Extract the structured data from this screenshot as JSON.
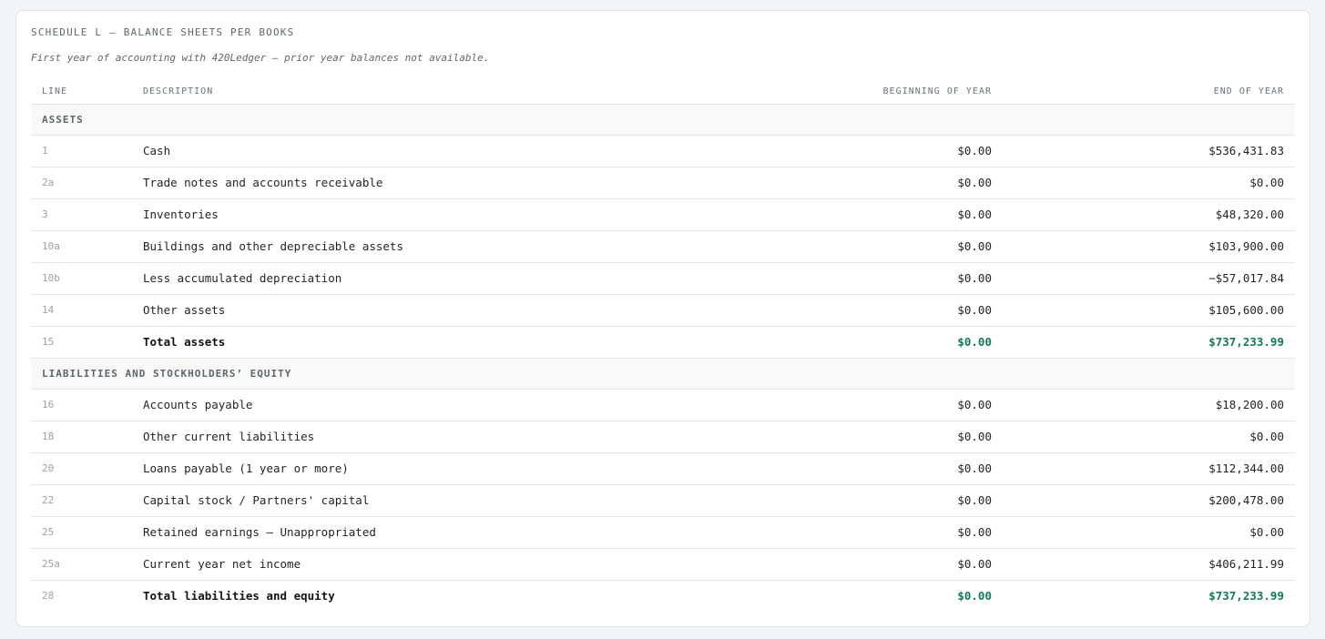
{
  "schedule": {
    "title": "SCHEDULE L — BALANCE SHEETS PER BOOKS",
    "note": "First year of accounting with 420Ledger — prior year balances not available."
  },
  "columns": {
    "line": "LINE",
    "description": "DESCRIPTION",
    "beginning": "BEGINNING OF YEAR",
    "end": "END OF YEAR"
  },
  "sections": [
    {
      "title": "ASSETS",
      "rows": [
        {
          "line": "1",
          "description": "Cash",
          "beginning": "$0.00",
          "end": "$536,431.83",
          "total": false
        },
        {
          "line": "2a",
          "description": "Trade notes and accounts receivable",
          "beginning": "$0.00",
          "end": "$0.00",
          "total": false
        },
        {
          "line": "3",
          "description": "Inventories",
          "beginning": "$0.00",
          "end": "$48,320.00",
          "total": false
        },
        {
          "line": "10a",
          "description": "Buildings and other depreciable assets",
          "beginning": "$0.00",
          "end": "$103,900.00",
          "total": false
        },
        {
          "line": "10b",
          "description": "Less accumulated depreciation",
          "beginning": "$0.00",
          "end": "−$57,017.84",
          "total": false
        },
        {
          "line": "14",
          "description": "Other assets",
          "beginning": "$0.00",
          "end": "$105,600.00",
          "total": false
        },
        {
          "line": "15",
          "description": "Total assets",
          "beginning": "$0.00",
          "end": "$737,233.99",
          "total": true
        }
      ]
    },
    {
      "title": "LIABILITIES AND STOCKHOLDERS’ EQUITY",
      "rows": [
        {
          "line": "16",
          "description": "Accounts payable",
          "beginning": "$0.00",
          "end": "$18,200.00",
          "total": false
        },
        {
          "line": "18",
          "description": "Other current liabilities",
          "beginning": "$0.00",
          "end": "$0.00",
          "total": false
        },
        {
          "line": "20",
          "description": "Loans payable (1 year or more)",
          "beginning": "$0.00",
          "end": "$112,344.00",
          "total": false
        },
        {
          "line": "22",
          "description": "Capital stock / Partners' capital",
          "beginning": "$0.00",
          "end": "$200,478.00",
          "total": false
        },
        {
          "line": "25",
          "description": "Retained earnings — Unappropriated",
          "beginning": "$0.00",
          "end": "$0.00",
          "total": false
        },
        {
          "line": "25a",
          "description": "Current year net income",
          "beginning": "$0.00",
          "end": "$406,211.99",
          "total": false
        },
        {
          "line": "28",
          "description": "Total liabilities and equity",
          "beginning": "$0.00",
          "end": "$737,233.99",
          "total": true
        }
      ]
    }
  ],
  "colors": {
    "total_accent": "#0f7a55",
    "background": "#f3f4f6",
    "card": "#ffffff"
  }
}
